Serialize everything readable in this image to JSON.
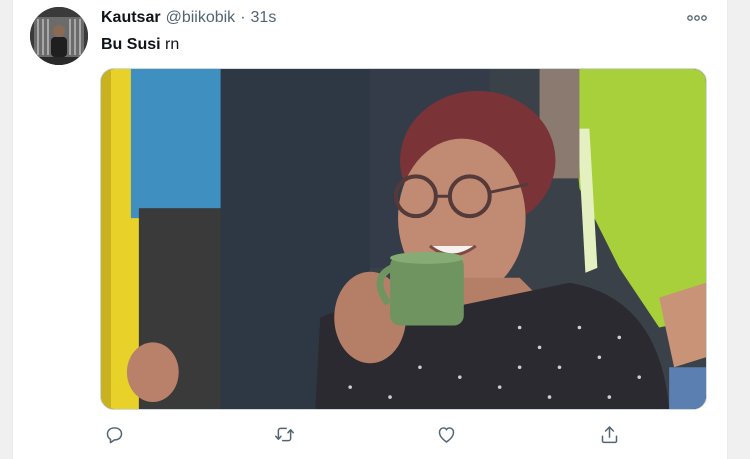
{
  "tweet": {
    "display_name": "Kautsar",
    "handle": "@biikobik",
    "separator": "·",
    "time": "31s",
    "text_bold": "Bu Susi",
    "text_rest": " rn"
  },
  "icons": {
    "more": "more-horizontal-icon",
    "reply": "reply-icon",
    "retweet": "retweet-icon",
    "like": "heart-icon",
    "share": "share-icon"
  },
  "colors": {
    "text_primary": "#0f1419",
    "text_secondary": "#536471",
    "icon": "#536471",
    "border": "#cfd9de"
  }
}
